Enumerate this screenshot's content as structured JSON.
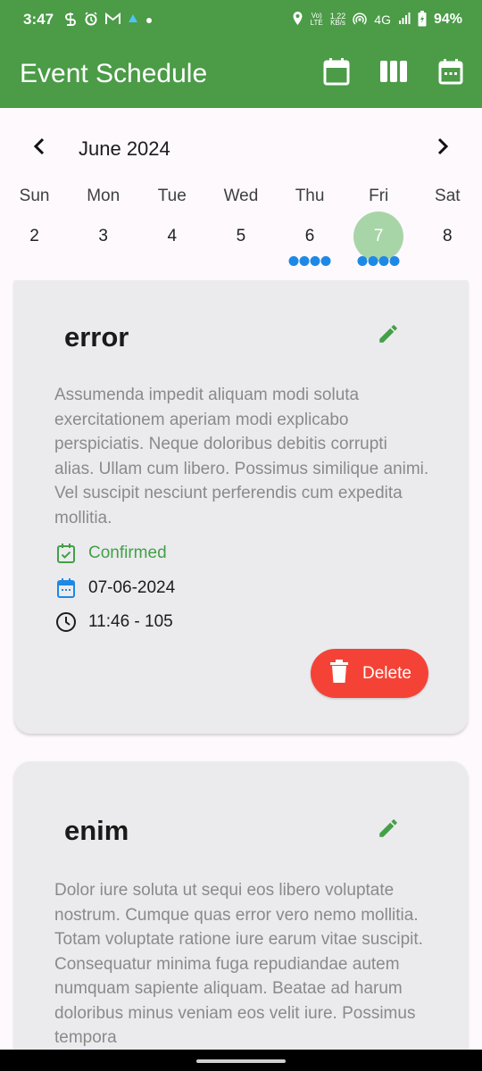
{
  "status_bar": {
    "time": "3:47",
    "network_speed_top": "1.22",
    "network_speed_bottom": "KB/s",
    "volte_top": "Vo)",
    "volte_bottom": "LTE",
    "network_type": "4G",
    "battery": "94%"
  },
  "app_bar": {
    "title": "Event Schedule",
    "actions": [
      {
        "icon": "calendar-month-view-icon"
      },
      {
        "icon": "week-columns-view-icon"
      },
      {
        "icon": "calendar-day-view-icon"
      }
    ]
  },
  "calendar": {
    "month_label": "June 2024",
    "prev_icon": "chevron-left-icon",
    "next_icon": "chevron-right-icon",
    "days": [
      {
        "name": "Sun",
        "num": "2",
        "dots": 0,
        "selected": false
      },
      {
        "name": "Mon",
        "num": "3",
        "dots": 0,
        "selected": false
      },
      {
        "name": "Tue",
        "num": "4",
        "dots": 0,
        "selected": false
      },
      {
        "name": "Wed",
        "num": "5",
        "dots": 0,
        "selected": false
      },
      {
        "name": "Thu",
        "num": "6",
        "dots": 4,
        "selected": false
      },
      {
        "name": "Fri",
        "num": "7",
        "dots": 4,
        "selected": true
      },
      {
        "name": "Sat",
        "num": "8",
        "dots": 0,
        "selected": false
      }
    ],
    "selected_color": "#a8d5a7",
    "dot_color": "#1e88e5"
  },
  "events": [
    {
      "title": "error",
      "description": "Assumenda impedit aliquam modi soluta exercitationem aperiam modi explicabo perspiciatis. Neque doloribus debitis corrupti alias. Ullam cum libero. Possimus similique animi. Vel suscipit nesciunt perferendis cum expedita mollitia.",
      "status": "Confirmed",
      "date": "07-06-2024",
      "time": "11:46 - 105",
      "delete_label": "Delete"
    },
    {
      "title": "enim",
      "description": "Dolor iure soluta ut sequi eos libero voluptate nostrum. Cumque quas error vero nemo mollitia. Totam voluptate ratione iure earum vitae suscipit. Consequatur minima fuga repudiandae autem numquam sapiente aliquam. Beatae ad harum doloribus minus veniam eos velit iure. Possimus tempora"
    }
  ],
  "colors": {
    "app_bar": "#4b9b47",
    "status_confirmed": "#43a047",
    "delete_button": "#f44336",
    "edit_icon": "#43a047",
    "card_bg": "#ebebee"
  }
}
